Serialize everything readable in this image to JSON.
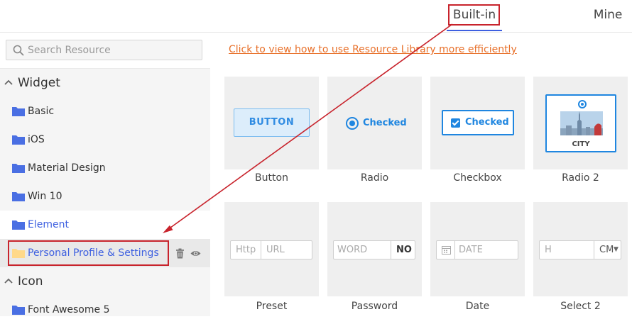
{
  "tabs": {
    "builtin": "Built-in",
    "mine": "Mine"
  },
  "search": {
    "placeholder": "Search Resource",
    "icon": "search-icon"
  },
  "help_link": "Click to view how to use Resource Library more efficiently",
  "colors": {
    "accent": "#3d5fe0",
    "link": "#e8702a",
    "highlight": "#c8232c",
    "primary": "#1f86e0"
  },
  "sidebar": {
    "widget_title": "Widget",
    "items": [
      {
        "label": "Basic"
      },
      {
        "label": "iOS"
      },
      {
        "label": "Material Design"
      },
      {
        "label": "Win 10"
      },
      {
        "label": "Element"
      },
      {
        "label": "Personal Profile & Settings"
      }
    ],
    "icon_title": "Icon",
    "icon_items": [
      {
        "label": "Font Awesome 5"
      }
    ]
  },
  "widgets": [
    {
      "name": "Button",
      "preview_text": "BUTTON"
    },
    {
      "name": "Radio",
      "preview_text": "Checked"
    },
    {
      "name": "Checkbox",
      "preview_text": "Checked"
    },
    {
      "name": "Radio 2",
      "preview_text": "CITY"
    },
    {
      "name": "Preset",
      "preview_prefix": "Http",
      "preview_text": "URL"
    },
    {
      "name": "Password",
      "preview_text": "WORD",
      "preview_suffix": "NO"
    },
    {
      "name": "Date",
      "preview_text": "DATE"
    },
    {
      "name": "Select 2",
      "preview_text": "H",
      "preview_suffix": "CM"
    }
  ]
}
